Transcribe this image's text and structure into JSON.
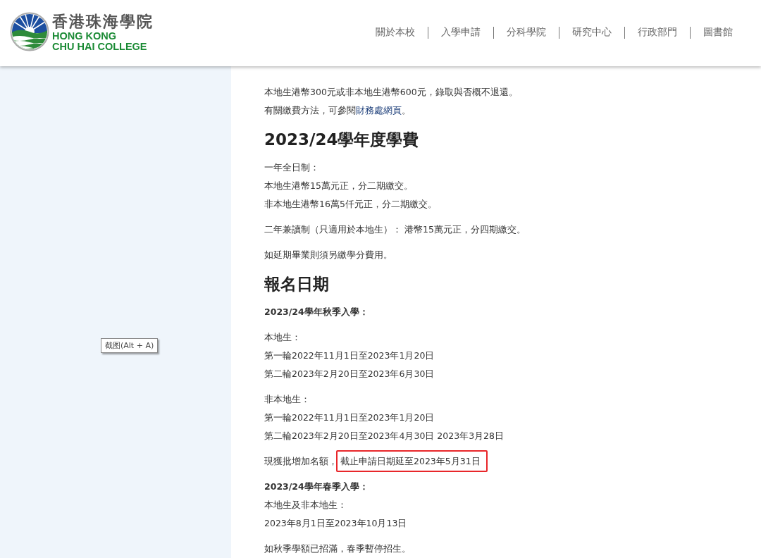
{
  "logo": {
    "chinese_name": "香港珠海學院",
    "english_lines": [
      "HONG KONG",
      "CHU HAI COLLEGE"
    ]
  },
  "nav": [
    "關於本校",
    "入學申請",
    "分科學院",
    "研究中心",
    "行政部門",
    "圖書館"
  ],
  "tooltip": "截图(Alt + A)",
  "content": [
    {
      "kind": "paragraph",
      "lines": [
        [
          {
            "kind": "plain",
            "text": "本地生港幣300元或非本地生港幣600元，錄取與否概不退還。"
          }
        ],
        [
          {
            "kind": "plain",
            "text": "有關繳費方法，可參閱"
          },
          {
            "kind": "link",
            "text": "財務處網頁"
          },
          {
            "kind": "plain",
            "text": "。"
          }
        ]
      ]
    },
    {
      "kind": "heading",
      "text": "2023/24學年度學費"
    },
    {
      "kind": "paragraph",
      "lines": [
        [
          {
            "kind": "plain",
            "text": "一年全日制："
          }
        ],
        [
          {
            "kind": "plain",
            "text": "本地生港幣15萬元正，分二期繳交。"
          }
        ],
        [
          {
            "kind": "plain",
            "text": "非本地生港幣16萬5仟元正，分二期繳交。"
          }
        ]
      ]
    },
    {
      "kind": "paragraph",
      "lines": [
        [
          {
            "kind": "plain",
            "text": "二年兼讀制（只適用於本地生）： 港幣15萬元正，分四期繳交。"
          }
        ]
      ]
    },
    {
      "kind": "paragraph",
      "lines": [
        [
          {
            "kind": "plain",
            "text": "如延期畢業則須另繳學分費用。"
          }
        ]
      ]
    },
    {
      "kind": "heading",
      "text": "報名日期"
    },
    {
      "kind": "paragraph",
      "lines": [
        [
          {
            "kind": "bold",
            "text": "2023/24學年秋季入學："
          }
        ]
      ]
    },
    {
      "kind": "paragraph",
      "lines": [
        [
          {
            "kind": "plain",
            "text": "本地生："
          }
        ],
        [
          {
            "kind": "plain",
            "text": "第一輪2022年11月1日至2023年1月20日"
          }
        ],
        [
          {
            "kind": "plain",
            "text": "第二輪2023年2月20日至2023年6月30日"
          }
        ]
      ]
    },
    {
      "kind": "paragraph",
      "lines": [
        [
          {
            "kind": "plain",
            "text": "非本地生："
          }
        ],
        [
          {
            "kind": "plain",
            "text": "第一輪2022年11月1日至2023年1月20日"
          }
        ],
        [
          {
            "kind": "plain",
            "text": "第二輪2023年2月20日至2023年4月30日 2023年3月28日"
          }
        ]
      ]
    },
    {
      "kind": "paragraph",
      "lines": [
        [
          {
            "kind": "plain",
            "text": "現獲批增加名額，"
          },
          {
            "kind": "highlight",
            "text": "截止申請日期延至2023年5月31日"
          }
        ]
      ]
    },
    {
      "kind": "paragraph",
      "lines": [
        [
          {
            "kind": "bold",
            "text": "2023/24學年春季入學："
          }
        ],
        [
          {
            "kind": "plain",
            "text": "本地生及非本地生："
          }
        ],
        [
          {
            "kind": "plain",
            "text": "2023年8月1日至2023年10月13日"
          }
        ]
      ]
    },
    {
      "kind": "paragraph",
      "lines": [
        [
          {
            "kind": "plain",
            "text": "如秋季學額已招滿，春季暫停招生。"
          }
        ]
      ]
    }
  ]
}
